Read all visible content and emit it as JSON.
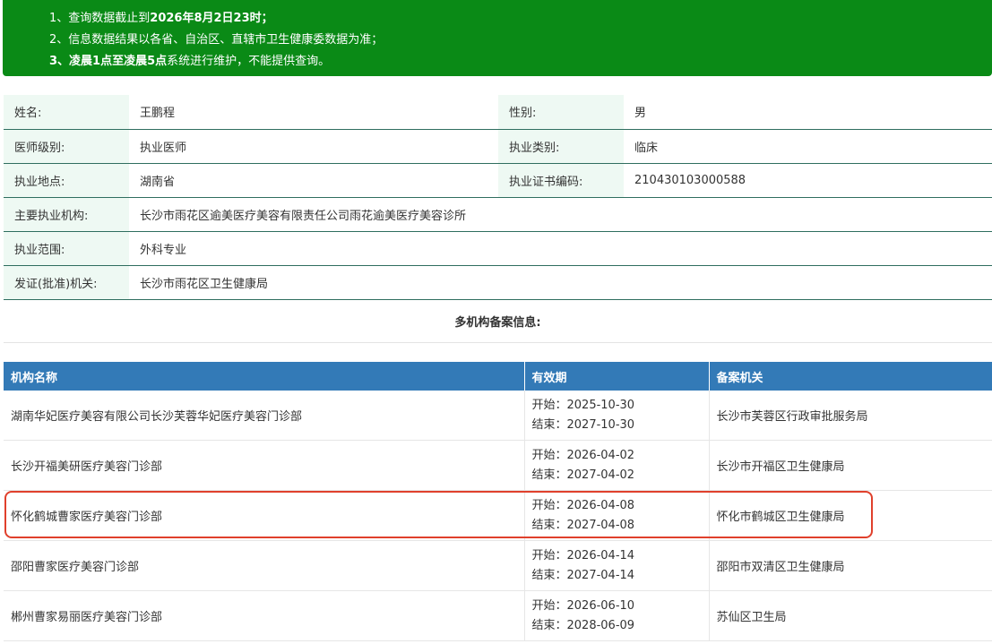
{
  "notice": {
    "line1_prefix": "1、查询数据截止到",
    "line1_bold": "2026年8月2日23时",
    "line1_suffix": "；",
    "line2": "2、信息数据结果以各省、自治区、直辖市卫生健康委数据为准；",
    "line3_prefix": "3、",
    "line3_bold": "凌晨1点至凌晨5点",
    "line3_suffix": "系统进行维护，不能提供查询。"
  },
  "info": {
    "name_label": "姓名:",
    "name": "王鹏程",
    "gender_label": "性别:",
    "gender": "男",
    "level_label": "医师级别:",
    "level": "执业医师",
    "category_label": "执业类别:",
    "category": "临床",
    "location_label": "执业地点:",
    "location": "湖南省",
    "cert_label": "执业证书编码:",
    "cert": "210430103000588",
    "institution_label": "主要执业机构:",
    "institution": "长沙市雨花区逾美医疗美容有限责任公司雨花逾美医疗美容诊所",
    "scope_label": "执业范围:",
    "scope": "外科专业",
    "authority_label": "发证(批准)机关:",
    "authority": "长沙市雨花区卫生健康局"
  },
  "multi_title": "多机构备案信息:",
  "orgs": {
    "headers": [
      "机构名称",
      "有效期",
      "备案机关"
    ],
    "rows": [
      {
        "name": "湖南华妃医疗美容有限公司长沙芙蓉华妃医疗美容门诊部",
        "start": "开始：2025-10-30",
        "end": "结束：2027-10-30",
        "authority": "长沙市芙蓉区行政审批服务局"
      },
      {
        "name": "长沙开福美研医疗美容门诊部",
        "start": "开始：2026-04-02",
        "end": "结束：2027-04-02",
        "authority": "长沙市开福区卫生健康局"
      },
      {
        "name": "怀化鹤城曹家医疗美容门诊部",
        "start": "开始：2026-04-08",
        "end": "结束：2027-04-08",
        "authority": "怀化市鹤城区卫生健康局"
      },
      {
        "name": "邵阳曹家医疗美容门诊部",
        "start": "开始：2026-04-14",
        "end": "结束：2027-04-14",
        "authority": "邵阳市双清区卫生健康局"
      },
      {
        "name": "郴州曹家易丽医疗美容门诊部",
        "start": "开始：2026-06-10",
        "end": "结束：2028-06-09",
        "authority": "苏仙区卫生局"
      }
    ]
  },
  "colors": {
    "notice_bg": "#0a8a16",
    "label_bg": "#eef9f3",
    "table_header_bg": "#337ab7",
    "highlight": "#e0402c"
  }
}
